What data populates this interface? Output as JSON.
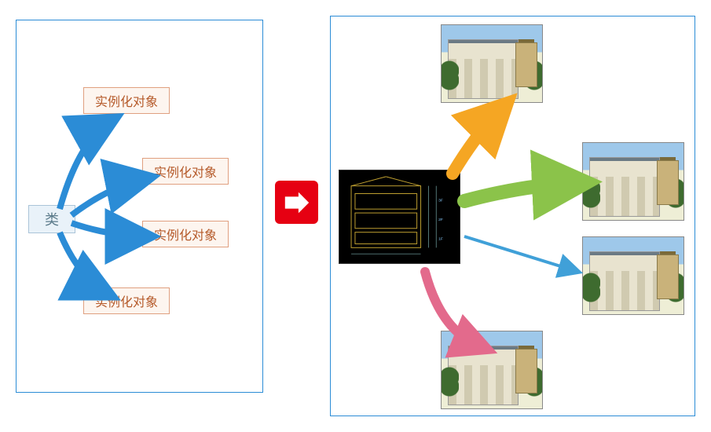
{
  "left": {
    "class_label": "类",
    "instances": [
      "实例化对象",
      "实例化对象",
      "实例化对象",
      "实例化对象"
    ]
  },
  "right": {
    "source_label": "blueprint",
    "outputs": [
      "house-1",
      "house-2",
      "house-3",
      "house-4"
    ]
  },
  "arrow_colors": {
    "big_orange": "#f5a623",
    "big_green": "#8bc34a",
    "thin_blue": "#40a0d8",
    "big_pink": "#e36a8c",
    "left_arrows": "#2b8cd6",
    "mid_bg": "#e60012"
  }
}
